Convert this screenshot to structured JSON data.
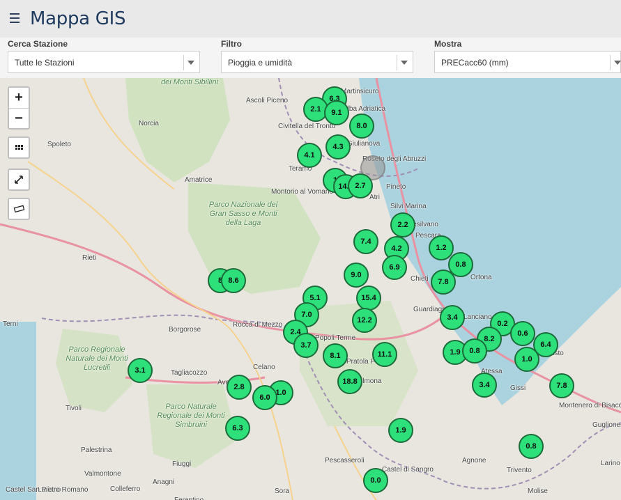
{
  "header": {
    "title": "Mappa GIS",
    "menu_icon": "hamburger-menu-icon"
  },
  "filters": {
    "station": {
      "label": "Cerca Stazione",
      "value": "Tutte le Stazioni"
    },
    "filter": {
      "label": "Filtro",
      "value": "Pioggia e umidità"
    },
    "show": {
      "label": "Mostra",
      "value": "PRECacc60 (mm)"
    }
  },
  "map_controls": {
    "zoom_in": "+",
    "zoom_out": "−"
  },
  "colors": {
    "marker_fill": "#2de07a",
    "marker_border": "#1c6b3a",
    "sea": "#aad3df",
    "land": "#e8e6df",
    "park": "#c8dfb4"
  },
  "places": [
    "dei Monti Sibillini",
    "Ascoli Piceno",
    "Martinsicuro",
    "Alba Adriatica",
    "Norcia",
    "Civitella del Tronto",
    "Giulianova",
    "Spoleto",
    "Teramo",
    "Roseto degli Abruzzi",
    "Amatrice",
    "Pineto",
    "Montorio al Vomano",
    "Atri",
    "Silvi Marina",
    "Parco Nazionale del Gran Sasso e Monti della Laga",
    "Pescara",
    "Montesilvano",
    "Rieti",
    "Chieti",
    "Ortona",
    "Terni",
    "Lanciano",
    "Vasto",
    "Rocca di Mezzo",
    "Guardiagrele",
    "Popoli Terme",
    "Borgorose",
    "Sulmona",
    "Pratola Peligna",
    "Parco Regionale Naturale dei Monti Lucretili",
    "Celano",
    "Atessa",
    "Tagliacozzo",
    "Avezzano",
    "Gissi",
    "Tivoli",
    "Montenero di Bisaccia",
    "Parco Naturale Regionale dei Monti Simbruini",
    "Guglionesi",
    "Palestrina",
    "Fiuggi",
    "Castel di Sangro",
    "Agnone",
    "Valmontone",
    "Pescasseroli",
    "Larino",
    "Trivento",
    "Colleferro",
    "Anagni",
    "Sora",
    "Molise",
    "Lariano",
    "Ferentino",
    "Castel San Pietro Romano"
  ],
  "stations": [
    {
      "value": "6.3"
    },
    {
      "value": "2.1"
    },
    {
      "value": "9.1"
    },
    {
      "value": "8.0"
    },
    {
      "value": "4.3"
    },
    {
      "value": "4.1"
    },
    {
      "value": ""
    },
    {
      "value": "1"
    },
    {
      "value": "14.4"
    },
    {
      "value": "2.7"
    },
    {
      "value": "2.2"
    },
    {
      "value": "7.4"
    },
    {
      "value": "4.2"
    },
    {
      "value": "1.2"
    },
    {
      "value": "6.9"
    },
    {
      "value": "0.8"
    },
    {
      "value": "9.0"
    },
    {
      "value": "7.8"
    },
    {
      "value": "8"
    },
    {
      "value": "8.6"
    },
    {
      "value": "5.1"
    },
    {
      "value": "15.4"
    },
    {
      "value": "7.0"
    },
    {
      "value": "12.2"
    },
    {
      "value": "3.4"
    },
    {
      "value": "0.2"
    },
    {
      "value": "2.4"
    },
    {
      "value": "0.6"
    },
    {
      "value": "3.7"
    },
    {
      "value": "8.2"
    },
    {
      "value": "6.4"
    },
    {
      "value": "1.9"
    },
    {
      "value": "0.8"
    },
    {
      "value": "8.1"
    },
    {
      "value": "11.1"
    },
    {
      "value": "1.0"
    },
    {
      "value": "3.1"
    },
    {
      "value": "18.8"
    },
    {
      "value": "2.8"
    },
    {
      "value": "1.0"
    },
    {
      "value": "6.0"
    },
    {
      "value": "3.4"
    },
    {
      "value": "7.8"
    },
    {
      "value": "6.3"
    },
    {
      "value": "1.9"
    },
    {
      "value": "0.8"
    },
    {
      "value": "0.0"
    }
  ]
}
